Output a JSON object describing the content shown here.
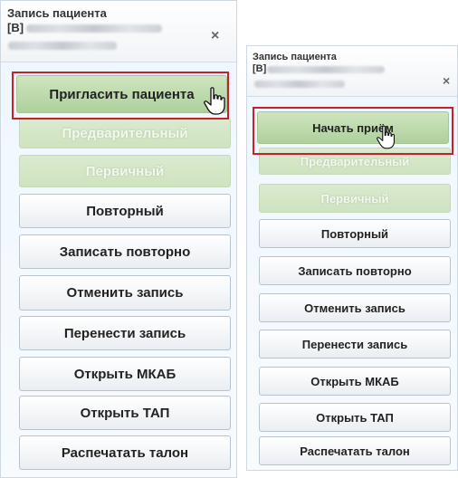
{
  "left_panel": {
    "title": "Запись пациента",
    "code_prefix": "[В]",
    "close_glyph": "×",
    "buttons": {
      "invite": "Пригласить пациента",
      "preliminary": "Предварительный",
      "primary": "Первичный",
      "repeat": "Повторный",
      "record_again": "Записать повторно",
      "cancel_record": "Отменить запись",
      "move_record": "Перенести запись",
      "open_mkab": "Открыть МКАБ",
      "open_tap": "Открыть ТАП",
      "print_ticket": "Распечатать талон"
    }
  },
  "right_panel": {
    "title": "Запись пациента",
    "code_prefix": "[В]",
    "close_glyph": "×",
    "buttons": {
      "start_reception": "Начать приём",
      "preliminary": "Предварительный",
      "primary": "Первичный",
      "repeat": "Повторный",
      "record_again": "Записать повторно",
      "cancel_record": "Отменить запись",
      "move_record": "Перенести запись",
      "open_mkab": "Открыть МКАБ",
      "open_tap": "Открыть ТАП",
      "print_ticket": "Распечатать талон"
    }
  },
  "colors": {
    "highlight": "#c8202b",
    "button_green": "#b9d8a8",
    "panel_bg": "#eef6ff"
  },
  "icons": [
    "close-icon",
    "hand-cursor-icon"
  ]
}
